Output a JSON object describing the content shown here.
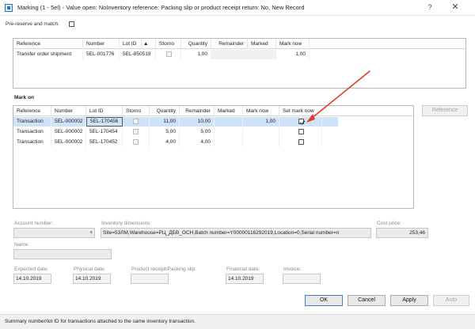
{
  "window": {
    "title": "Marking (1 - 5el) - Value open: NoInventory reference: Packing slip or product receipt return: No, New Record",
    "help_label": "?",
    "close_label": "✕"
  },
  "pre_reserve": {
    "label": "Pre-reserve and match:"
  },
  "top_grid": {
    "columns": [
      "Reference",
      "Number",
      "Lot ID",
      "Storno",
      "Quantity",
      "Remainder",
      "Marked",
      "Mark now"
    ],
    "sort_indicator": "▲",
    "row": {
      "reference": "Transfer order shipment",
      "number": "5EL-001776",
      "lot_id": "5EL-850519",
      "quantity": "1,00",
      "remainder": "",
      "marked": "",
      "mark_now": "1,00"
    }
  },
  "mark_on": {
    "label": "Mark on",
    "columns": [
      "Reference",
      "Number",
      "Lot ID",
      "Storno",
      "Quantity",
      "Remainder",
      "Marked",
      "Mark now",
      "Set mark now"
    ],
    "rows": [
      {
        "reference": "Transaction",
        "number": "5EL-000002",
        "lot_id": "5EL-170456",
        "quantity": "11,00",
        "remainder": "10,00",
        "marked": "",
        "mark_now": "1,00",
        "set": true
      },
      {
        "reference": "Transaction",
        "number": "5EL-000002",
        "lot_id": "5EL-170454",
        "quantity": "5,00",
        "remainder": "5,00",
        "marked": "",
        "mark_now": "",
        "set": false
      },
      {
        "reference": "Transaction",
        "number": "5EL-000002",
        "lot_id": "5EL-170452",
        "quantity": "4,00",
        "remainder": "4,00",
        "marked": "",
        "mark_now": "",
        "set": false
      }
    ],
    "reference_button": "Reference"
  },
  "details": {
    "account_number": {
      "label": "Account number:",
      "value": ""
    },
    "inventory_dimensions": {
      "label": "Inventory dimensions:",
      "value": "Site=53ЛМ,Warehouse=РЦ_ДБВ_ОСН,Batch number=Y00000116292019,Location=0,Serial number=n"
    },
    "cost_price": {
      "label": "Cost price:",
      "value": "253,46"
    },
    "name": {
      "label": "Name:",
      "value": ""
    },
    "expected_date": {
      "label": "Expected date:",
      "value": "14.10.2019"
    },
    "physical_date": {
      "label": "Physical date:",
      "value": "14.10.2019"
    },
    "product_receipt": {
      "label": "Product receipt/Packing slip:",
      "value": ""
    },
    "financial_date": {
      "label": "Financial date:",
      "value": "14.10.2019"
    },
    "invoice": {
      "label": "Invoice:",
      "value": ""
    }
  },
  "buttons": {
    "ok": "OK",
    "cancel": "Cancel",
    "apply": "Apply",
    "auto": "Auto"
  },
  "status": {
    "text": "Summary number/lot ID for transactions attached to the same inventory transaction."
  },
  "colors": {
    "selected_row": "#cfe3f7",
    "arrow": "#e23b2e",
    "default_button_border": "#3c7fd1"
  }
}
